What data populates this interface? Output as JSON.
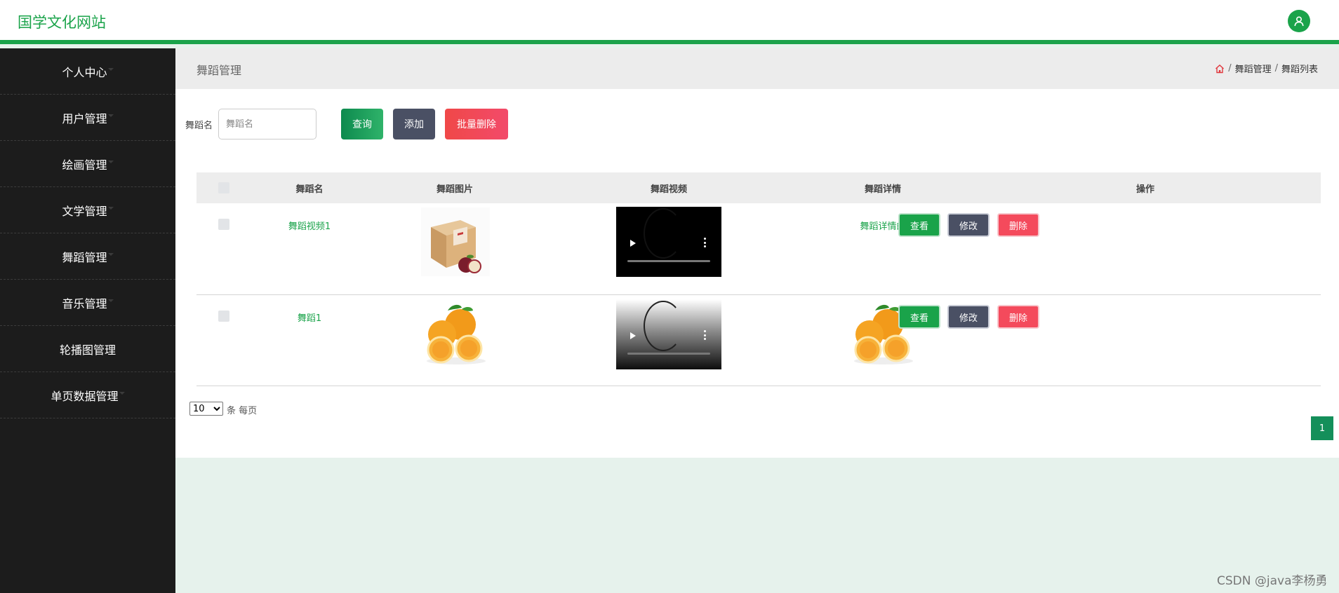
{
  "header": {
    "site_title": "国学文化网站",
    "avatar_icon": "user-icon"
  },
  "sidebar": {
    "items": [
      {
        "label": "个人中心"
      },
      {
        "label": "用户管理"
      },
      {
        "label": "绘画管理"
      },
      {
        "label": "文学管理"
      },
      {
        "label": "舞蹈管理"
      },
      {
        "label": "音乐管理"
      },
      {
        "label": "轮播图管理"
      },
      {
        "label": "单页数据管理"
      }
    ]
  },
  "titlebar": {
    "title": "舞蹈管理",
    "breadcrumb": {
      "home_icon": "home-icon",
      "separator": "/",
      "level1": "舞蹈管理",
      "level2": "舞蹈列表"
    }
  },
  "search": {
    "label": "舞蹈名",
    "placeholder": "舞蹈名",
    "value": "",
    "query_label": "查询",
    "add_label": "添加",
    "batch_delete_label": "批量删除"
  },
  "table": {
    "columns": [
      "舞蹈名",
      "舞蹈图片",
      "舞蹈视频",
      "舞蹈详情",
      "操作"
    ],
    "rows": [
      {
        "name": "舞蹈视频1",
        "image": "apple-box-image",
        "video": "video-player",
        "detail": "舞蹈详情的"
      },
      {
        "name": "舞蹈1",
        "image": "oranges-image",
        "video": "video-player",
        "detail": "oranges-image"
      }
    ],
    "actions": {
      "view": "查看",
      "edit": "修改",
      "delete": "删除"
    }
  },
  "pagination": {
    "page_size": "10",
    "page_size_options": [
      "10"
    ],
    "per_page_label": "条 每页",
    "current_page": "1"
  },
  "watermark": "CSDN @java李杨勇",
  "colors": {
    "primary": "#1aa34a",
    "sidebar": "#1c1c1c",
    "danger": "#f44a5c",
    "neutral": "#4a5064",
    "page_bg": "#e6f2ec"
  }
}
